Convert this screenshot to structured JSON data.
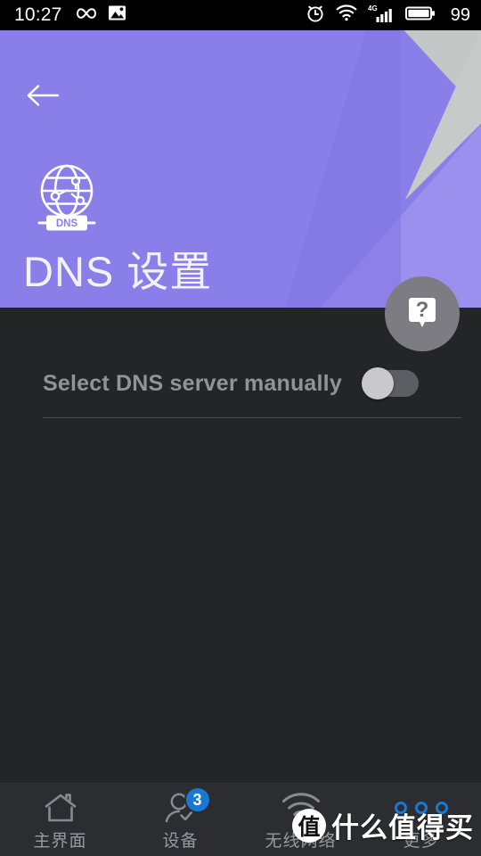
{
  "status_bar": {
    "time": "10:27",
    "battery_percent": "99",
    "left_icons": [
      "infinity-icon",
      "image-icon"
    ],
    "right_icons": [
      "alarm-clock-icon",
      "wifi-icon",
      "signal-4g-icon",
      "battery-icon"
    ],
    "network_type": "4G"
  },
  "header": {
    "back_label": "back",
    "icon_name": "dns-globe-icon",
    "icon_caption": "DNS",
    "title": "DNS 设置",
    "accent_color": "#8a7ee8",
    "fold_light_color": "#9b90ee",
    "fold_gray_color": "#c6cbc9"
  },
  "help_button": {
    "name": "help-fab",
    "glyph": "?",
    "background": "#7c7c82"
  },
  "main": {
    "settings": [
      {
        "label": "Select DNS server manually",
        "toggle_state": "off"
      }
    ],
    "background": "#232527"
  },
  "bottom_nav": {
    "items": [
      {
        "label": "主界面",
        "icon": "home-icon",
        "badge": "",
        "active": false
      },
      {
        "label": "设备",
        "icon": "user-check-icon",
        "badge": "3",
        "active": false
      },
      {
        "label": "无线网络",
        "icon": "wifi-icon",
        "badge": "",
        "active": false
      },
      {
        "label": "更多",
        "icon": "more-dots-icon",
        "badge": "",
        "active": true
      }
    ],
    "badge_color": "#1878d4"
  },
  "watermark": {
    "logo_text": "值",
    "text": "什么值得买"
  }
}
